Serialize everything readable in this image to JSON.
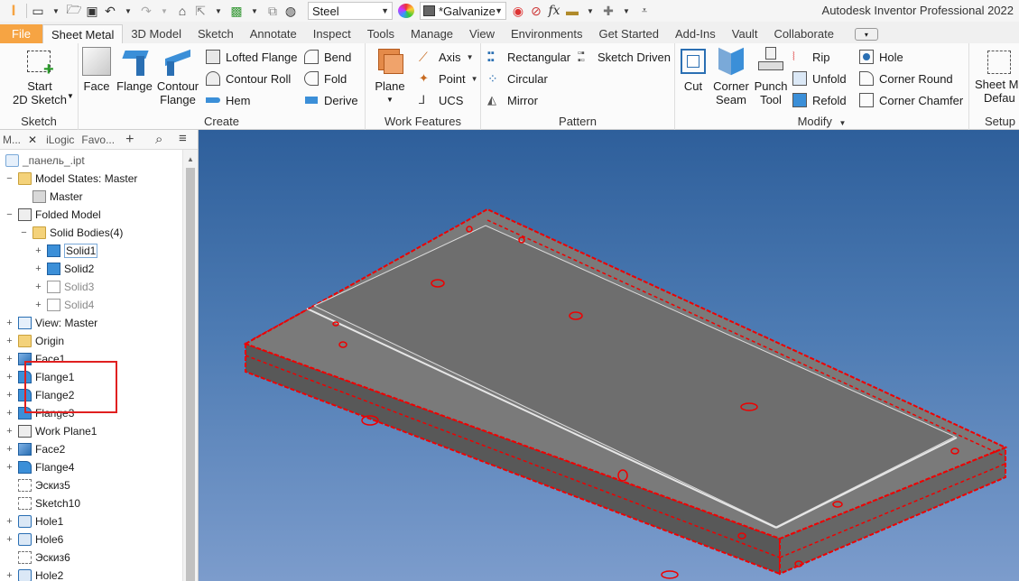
{
  "app": {
    "title": "Autodesk Inventor Professional 2022"
  },
  "qat": {
    "material": "Steel",
    "appearance": "*Galvanize",
    "fx": "fx"
  },
  "tabs": [
    "File",
    "Sheet Metal",
    "3D Model",
    "Sketch",
    "Annotate",
    "Inspect",
    "Tools",
    "Manage",
    "View",
    "Environments",
    "Get Started",
    "Add-Ins",
    "Vault",
    "Collaborate"
  ],
  "ribbon": {
    "sketch": {
      "label": "Sketch",
      "start_line1": "Start",
      "start_line2": "2D Sketch"
    },
    "create": {
      "label": "Create",
      "face": "Face",
      "flange": "Flange",
      "contour_line1": "Contour",
      "contour_line2": "Flange",
      "lofted": "Lofted Flange",
      "contour_roll": "Contour Roll",
      "hem": "Hem",
      "bend": "Bend",
      "fold": "Fold",
      "derive": "Derive"
    },
    "work": {
      "label": "Work Features",
      "plane": "Plane",
      "axis": "Axis",
      "point": "Point",
      "ucs": "UCS"
    },
    "pattern": {
      "label": "Pattern",
      "rectangular": "Rectangular",
      "circular": "Circular",
      "mirror": "Mirror",
      "sketch_driven": "Sketch Driven"
    },
    "modify": {
      "label": "Modify",
      "cut": "Cut",
      "corner_line1": "Corner",
      "corner_line2": "Seam",
      "punch_line1": "Punch",
      "punch_line2": "Tool",
      "rip": "Rip",
      "unfold": "Unfold",
      "refold": "Refold",
      "hole": "Hole",
      "corner_round": "Corner Round",
      "corner_chamfer": "Corner Chamfer"
    },
    "setup": {
      "label": "Setup",
      "line1": "Sheet M",
      "line2": "Defau"
    }
  },
  "browser": {
    "tabs": [
      "М...",
      "iLogic",
      "Favo..."
    ],
    "file": "_панель_.ipt",
    "tree": [
      {
        "label": "Model States: Master",
        "indent": 0,
        "exp": "−",
        "icon": "folder-icon"
      },
      {
        "label": "Master",
        "indent": 1,
        "exp": "",
        "icon": "check-state-icon"
      },
      {
        "label": "Folded Model",
        "indent": 0,
        "exp": "−",
        "icon": "folded-model-icon"
      },
      {
        "label": "Solid Bodies(4)",
        "indent": 1,
        "exp": "−",
        "icon": "folder-icon"
      },
      {
        "label": "Solid1",
        "indent": 2,
        "exp": "+",
        "icon": "solid-body-icon",
        "selected": true
      },
      {
        "label": "Solid2",
        "indent": 2,
        "exp": "+",
        "icon": "solid-body-icon"
      },
      {
        "label": "Solid3",
        "indent": 2,
        "exp": "+",
        "icon": "solid-hidden-icon",
        "muted": true
      },
      {
        "label": "Solid4",
        "indent": 2,
        "exp": "+",
        "icon": "solid-hidden-icon",
        "muted": true
      },
      {
        "label": "View: Master",
        "indent": 0,
        "exp": "+",
        "icon": "view-icon"
      },
      {
        "label": "Origin",
        "indent": 0,
        "exp": "+",
        "icon": "folder-icon"
      },
      {
        "label": "Face1",
        "indent": 0,
        "exp": "+",
        "icon": "face-icon"
      },
      {
        "label": "Flange1",
        "indent": 0,
        "exp": "+",
        "icon": "flange-icon"
      },
      {
        "label": "Flange2",
        "indent": 0,
        "exp": "+",
        "icon": "flange-icon"
      },
      {
        "label": "Flange3",
        "indent": 0,
        "exp": "+",
        "icon": "flange-icon"
      },
      {
        "label": "Work Plane1",
        "indent": 0,
        "exp": "+",
        "icon": "work-plane-icon"
      },
      {
        "label": "Face2",
        "indent": 0,
        "exp": "+",
        "icon": "face-icon"
      },
      {
        "label": "Flange4",
        "indent": 0,
        "exp": "+",
        "icon": "flange-icon"
      },
      {
        "label": "Эскиз5",
        "indent": 0,
        "exp": "",
        "icon": "sketch-icon"
      },
      {
        "label": "Sketch10",
        "indent": 0,
        "exp": "",
        "icon": "sketch-icon"
      },
      {
        "label": "Hole1",
        "indent": 0,
        "exp": "+",
        "icon": "hole-icon"
      },
      {
        "label": "Hole6",
        "indent": 0,
        "exp": "+",
        "icon": "hole-icon"
      },
      {
        "label": "Эскиз6",
        "indent": 0,
        "exp": "",
        "icon": "sketch-icon"
      },
      {
        "label": "Hole2",
        "indent": 0,
        "exp": "+",
        "icon": "hole-icon"
      }
    ]
  },
  "colors": {
    "file_tab": "#f6a443",
    "highlight": "#e02020",
    "viewport_top": "#2e5f9b",
    "viewport_bottom": "#7c9ccc",
    "part": "#707070"
  }
}
